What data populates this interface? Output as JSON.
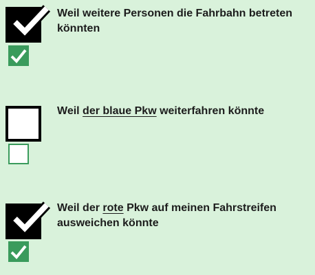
{
  "options": [
    {
      "label": "Weil weitere Personen die Fahrbahn betreten könnten",
      "checked": true,
      "small_checked": true
    },
    {
      "label_parts": [
        "Weil ",
        "der blaue Pkw",
        " weiterfahren könnte"
      ],
      "checked": false,
      "small_checked": false
    },
    {
      "label_parts": [
        "Weil der ",
        "rote",
        " Pkw auf meinen Fahrstreifen ausweichen könnte"
      ],
      "checked": true,
      "small_checked": true
    }
  ],
  "colors": {
    "background": "#d9f2db",
    "check_green": "#3a9b5c",
    "checkbox_black": "#000000"
  },
  "icons": {
    "large_check": "checkmark-icon",
    "small_check": "checkmark-icon"
  }
}
